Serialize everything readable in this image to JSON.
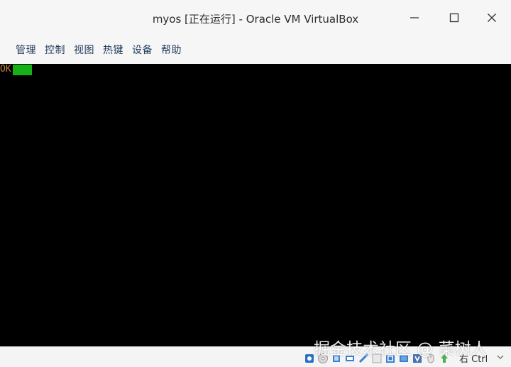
{
  "window": {
    "title": "myos [正在运行] - Oracle VM VirtualBox"
  },
  "menu": {
    "items": [
      {
        "label": "管理"
      },
      {
        "label": "控制"
      },
      {
        "label": "视图"
      },
      {
        "label": "热键"
      },
      {
        "label": "设备"
      },
      {
        "label": "帮助"
      }
    ]
  },
  "console": {
    "text": "OK",
    "text_color": "#c0813a",
    "cursor_color": "#15b015",
    "background": "#000000"
  },
  "statusbar": {
    "host_key": "右 Ctrl",
    "watermark": "掘金技术社区 @ 菜树人",
    "icons": [
      "hard-disk-icon",
      "optical-drive-icon",
      "audio-icon",
      "network-icon",
      "usb-icon",
      "shared-folders-icon",
      "display-icon",
      "video-capture-icon",
      "virtualization-icon",
      "mouse-integration-icon",
      "host-key-icon"
    ]
  }
}
